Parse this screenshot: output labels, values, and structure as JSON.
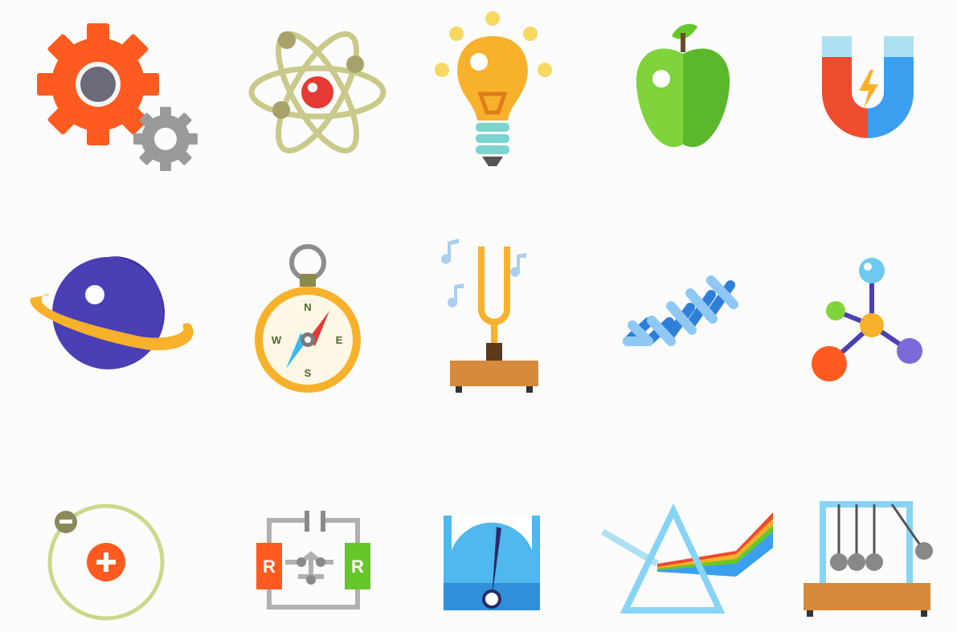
{
  "compass": {
    "n": "N",
    "s": "S",
    "e": "E",
    "w": "W"
  },
  "circuit": {
    "r1": "R",
    "r2": "R"
  },
  "atom_charges": {
    "nucleus": "+",
    "electron": "−"
  },
  "colors": {
    "orange": "#ff5a1f",
    "gray": "#8e8e8e",
    "olive": "#c9c98a",
    "red": "#e53935",
    "amber": "#f7b12b",
    "green": "#66c72a",
    "blue": "#3b9ff0",
    "purple": "#4b3fb5",
    "wood": "#d58a3c",
    "sky": "#87d4f5"
  },
  "icons": [
    "gears-icon",
    "atom-icon",
    "light-bulb-icon",
    "apple-icon",
    "magnet-icon",
    "planet-icon",
    "compass-icon",
    "tuning-fork-icon",
    "spring-icon",
    "molecule-icon",
    "charge-orbit-icon",
    "circuit-icon",
    "gauge-meter-icon",
    "prism-icon",
    "newtons-cradle-icon"
  ]
}
